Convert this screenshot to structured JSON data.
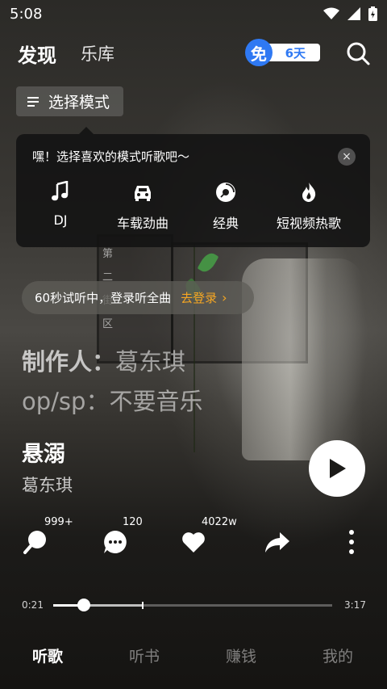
{
  "status_bar": {
    "time": "5:08",
    "icons": [
      "wifi-icon",
      "signal-icon",
      "battery-charging-icon"
    ]
  },
  "header": {
    "tabs": [
      "发现",
      "乐库"
    ],
    "vip_badge": "免",
    "vip_days": "6天",
    "search_icon": "search-icon"
  },
  "mode_button": {
    "label": "选择模式",
    "icon": "menu-lines-icon"
  },
  "mode_popup": {
    "tip": "嘿！选择喜欢的模式听歌吧～",
    "close": "×",
    "items": [
      {
        "label": "DJ",
        "icon": "music-note-icon"
      },
      {
        "label": "车载劲曲",
        "icon": "car-icon"
      },
      {
        "label": "经典",
        "icon": "vinyl-disc-icon"
      },
      {
        "label": "短视频热歌",
        "icon": "flame-icon"
      }
    ]
  },
  "background_text": "第二街区",
  "trial_banner": {
    "text": "60秒试听中，登录听全曲",
    "login": "去登录",
    "chevron": "›"
  },
  "lyrics": {
    "line1_left": "制作人：",
    "line1_right": "葛东琪",
    "line2": "op/sp：不要音乐"
  },
  "song": {
    "title": "悬溺",
    "artist": "葛东琪"
  },
  "actions": {
    "search_count": "999+",
    "comment_count": "120",
    "like_count": "4022w"
  },
  "progress": {
    "current": "0:21",
    "total": "3:17",
    "played_fraction": 0.11,
    "buffered_fraction": 0.32
  },
  "colors": {
    "accent_blue": "#2f79f3",
    "login_orange": "#f5a623"
  },
  "bottom_nav": [
    "听歌",
    "听书",
    "赚钱",
    "我的"
  ]
}
